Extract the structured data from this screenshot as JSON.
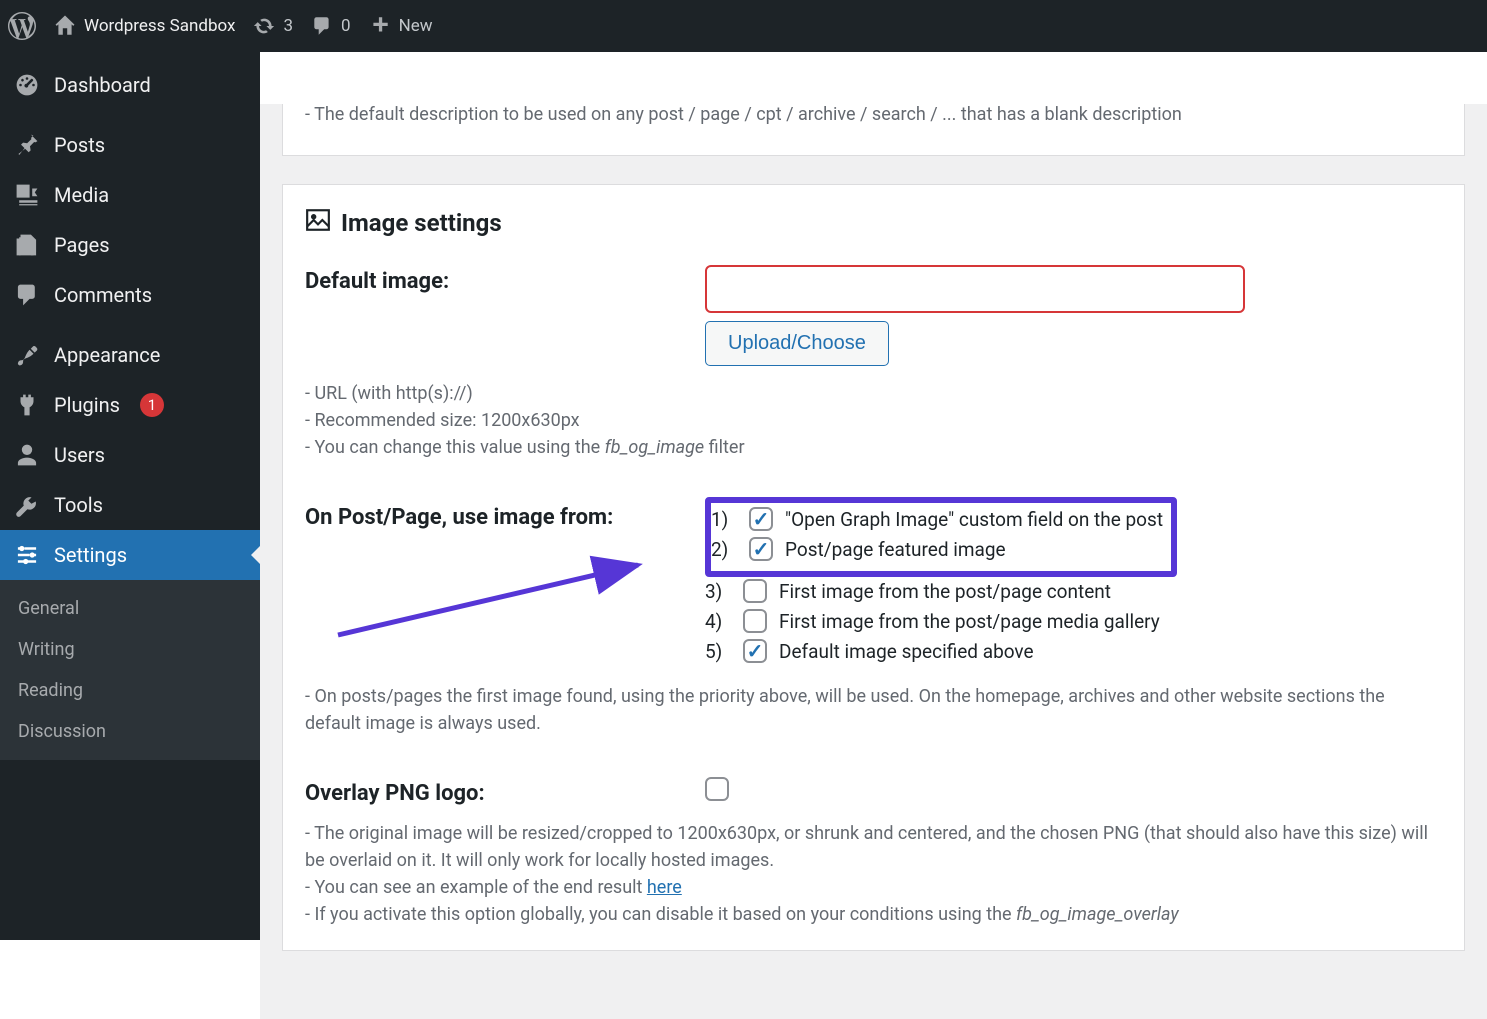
{
  "adminbar": {
    "site_name": "Wordpress Sandbox",
    "updates_count": "3",
    "comments_count": "0",
    "new_label": "New"
  },
  "sidebar": {
    "items": [
      {
        "key": "dashboard",
        "label": "Dashboard"
      },
      {
        "key": "posts",
        "label": "Posts"
      },
      {
        "key": "media",
        "label": "Media"
      },
      {
        "key": "pages",
        "label": "Pages"
      },
      {
        "key": "comments",
        "label": "Comments"
      },
      {
        "key": "appearance",
        "label": "Appearance"
      },
      {
        "key": "plugins",
        "label": "Plugins",
        "badge": "1"
      },
      {
        "key": "users",
        "label": "Users"
      },
      {
        "key": "tools",
        "label": "Tools"
      },
      {
        "key": "settings",
        "label": "Settings"
      }
    ],
    "submenu": [
      "General",
      "Writing",
      "Reading",
      "Discussion"
    ]
  },
  "top_card": {
    "description": "- The default description to be used on any post / page / cpt / archive / search / ... that has a blank description"
  },
  "image_settings": {
    "title": "Image settings",
    "default_image_label": "Default image:",
    "default_image_value": "",
    "upload_button": "Upload/Choose",
    "default_image_help_1": "- URL (with http(s)://)",
    "default_image_help_2": "- Recommended size: 1200x630px",
    "default_image_help_3_pre": "- You can change this value using the ",
    "default_image_help_3_em": "fb_og_image",
    "default_image_help_3_post": " filter",
    "on_post_label": "On Post/Page, use image from:",
    "priority_options": [
      {
        "num": "1)",
        "label": "\"Open Graph Image\" custom field on the post",
        "checked": true
      },
      {
        "num": "2)",
        "label": "Post/page featured image",
        "checked": true
      },
      {
        "num": "3)",
        "label": "First image from the post/page content",
        "checked": false
      },
      {
        "num": "4)",
        "label": "First image from the post/page media gallery",
        "checked": false
      },
      {
        "num": "5)",
        "label": "Default image specified above",
        "checked": true
      }
    ],
    "priority_help": "- On posts/pages the first image found, using the priority above, will be used. On the homepage, archives and other website sections the default image is always used.",
    "overlay_label": "Overlay PNG logo:",
    "overlay_checked": false,
    "overlay_help_1": "- The original image will be resized/cropped to 1200x630px, or shrunk and centered, and the chosen PNG (that should also have this size) will be overlaid on it. It will only work for locally hosted images.",
    "overlay_help_2_pre": "- You can see an example of the end result ",
    "overlay_help_2_link": "here",
    "overlay_help_3_pre": "- If you activate this option globally, you can disable it based on your conditions using the ",
    "overlay_help_3_em": "fb_og_image_overlay"
  }
}
